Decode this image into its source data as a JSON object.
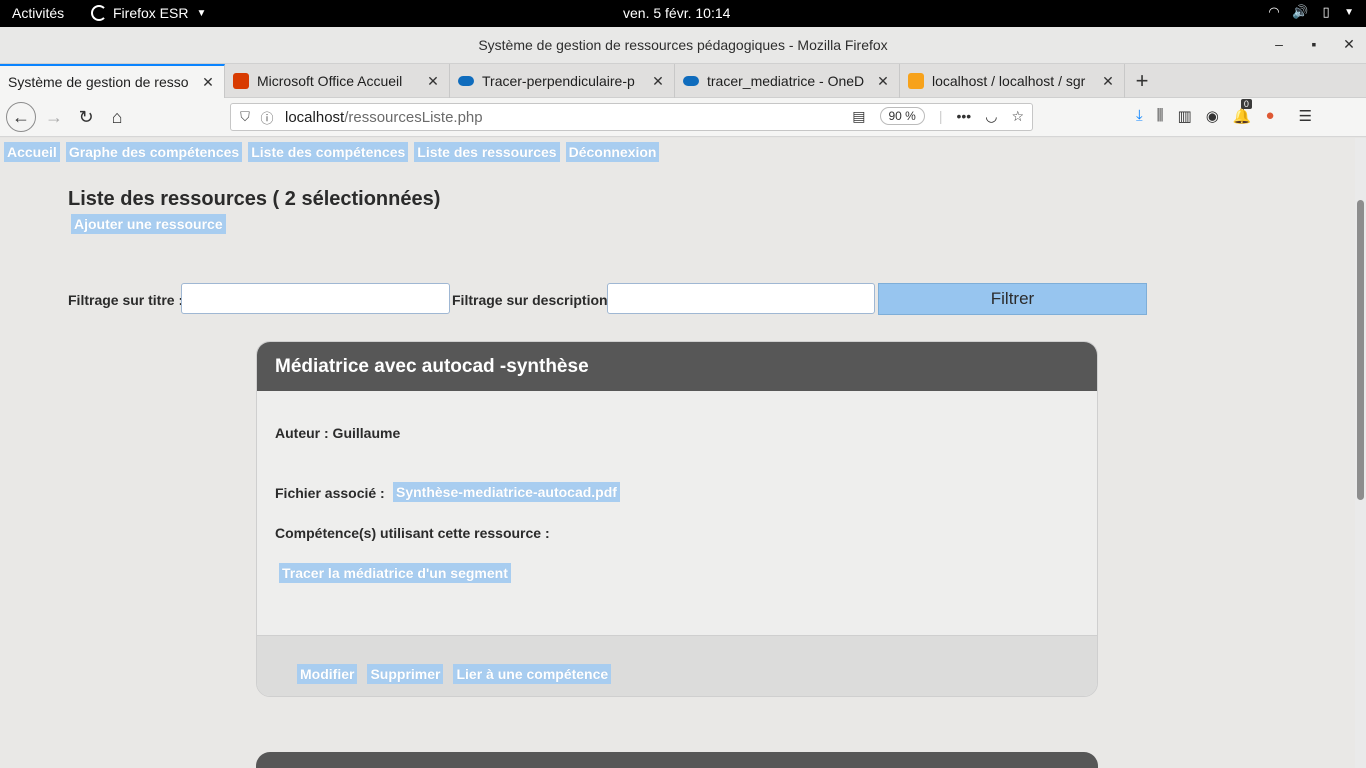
{
  "system": {
    "activities": "Activités",
    "app_name": "Firefox ESR",
    "clock": "ven. 5 févr.  10:14"
  },
  "window": {
    "title": "Système de gestion de ressources pédagogiques - Mozilla Firefox"
  },
  "tabs": [
    {
      "label": "Système de gestion de resso",
      "icon_color": "#f5f5f4"
    },
    {
      "label": "Microsoft Office Accueil",
      "icon_color": "#d83b01"
    },
    {
      "label": "Tracer-perpendiculaire-p",
      "icon_color": "#0f6cbd"
    },
    {
      "label": "tracer_mediatrice - OneD",
      "icon_color": "#0f6cbd"
    },
    {
      "label": "localhost / localhost / sgr",
      "icon_color": "#f7a21b"
    }
  ],
  "navbar": {
    "url_host": "localhost",
    "url_path": "/ressourcesListe.php",
    "zoom": "90 %",
    "notification_count": "0"
  },
  "page": {
    "menu": [
      "Accueil",
      "Graphe des compétences",
      "Liste des compétences",
      "Liste des ressources",
      "Déconnexion"
    ],
    "title": "Liste des ressources ( 2 sélectionnées)",
    "add_button": "Ajouter une ressource",
    "filter": {
      "title_label": "Filtrage sur titre :",
      "title_value": "",
      "desc_label": "Filtrage sur description :",
      "desc_value": "",
      "button": "Filtrer"
    },
    "resource": {
      "title": "Médiatrice avec autocad -synthèse",
      "author": "Auteur : Guillaume",
      "file_label": "Fichier associé :",
      "file_name": "Synthèse-mediatrice-autocad.pdf",
      "skills_label": "Compétence(s) utilisant cette ressource :",
      "skill": "Tracer la médiatrice d'un segment",
      "actions": [
        "Modifier",
        "Supprimer",
        "Lier à une compétence"
      ]
    }
  }
}
